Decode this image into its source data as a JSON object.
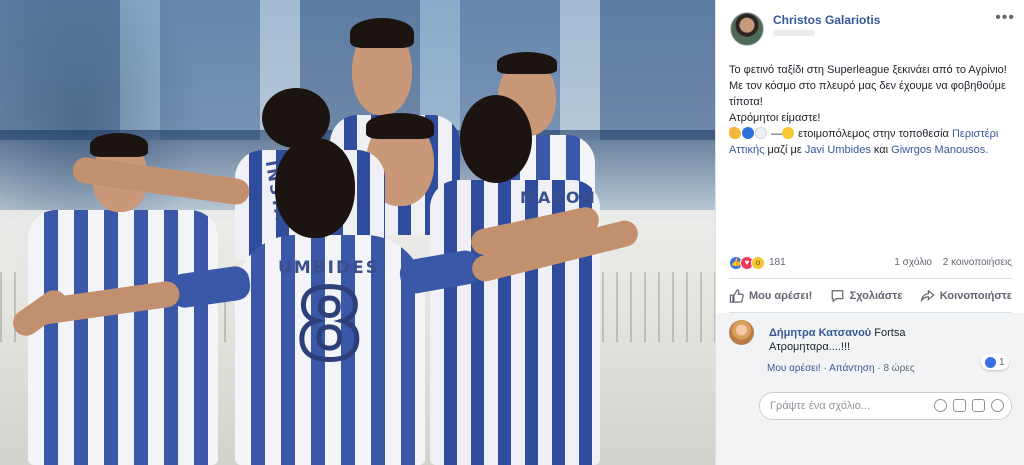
{
  "post": {
    "author": "Christos Galariotis",
    "more_icon": "more-options-icon",
    "text_lines": [
      "Το φετινό ταξίδι στη Superleague ξεκινάει από το Αγρίνιο!",
      "Με τον κόσμο στο πλευρό μας δεν έχουμε να φοβηθούμε τίποτα!",
      "Ατρόμητοι είμαστε!"
    ],
    "activity": {
      "dash": "—",
      "feeling": "ετοιμοπόλεμος στην τοποθεσία",
      "location": "Περιστέρι Αττικής",
      "with_word": "μαζί με",
      "tag1": "Javi Umbides",
      "and_word": "και",
      "tag2": "Giwrgos Manousos."
    },
    "reactions": {
      "count": "181",
      "comments": "1 σχόλιο",
      "shares": "2 κοινοποιήσεις"
    },
    "actions": {
      "like": "Μου αρέσει!",
      "comment": "Σχολιάστε",
      "share": "Κοινοποιήστε"
    }
  },
  "comment": {
    "name": "Δήμητρα Κατσανού",
    "text_first": "Fortsa",
    "text_second": "Ατρομηταρα....!!!",
    "likes": "1",
    "like_link": "Μου αρέσει!",
    "sep1": "·",
    "reply_link": "Απάντηση",
    "sep2": "·",
    "time": "8 ώρες"
  },
  "composer": {
    "placeholder": "Γράψτε ένα σχόλιο..."
  },
  "photo": {
    "jersey_number": "8",
    "jersey_names": [
      "UMBIDES",
      "MASON",
      "INSTA"
    ]
  },
  "colors": {
    "link": "#365899",
    "kit_blue": "#3a57a8"
  }
}
